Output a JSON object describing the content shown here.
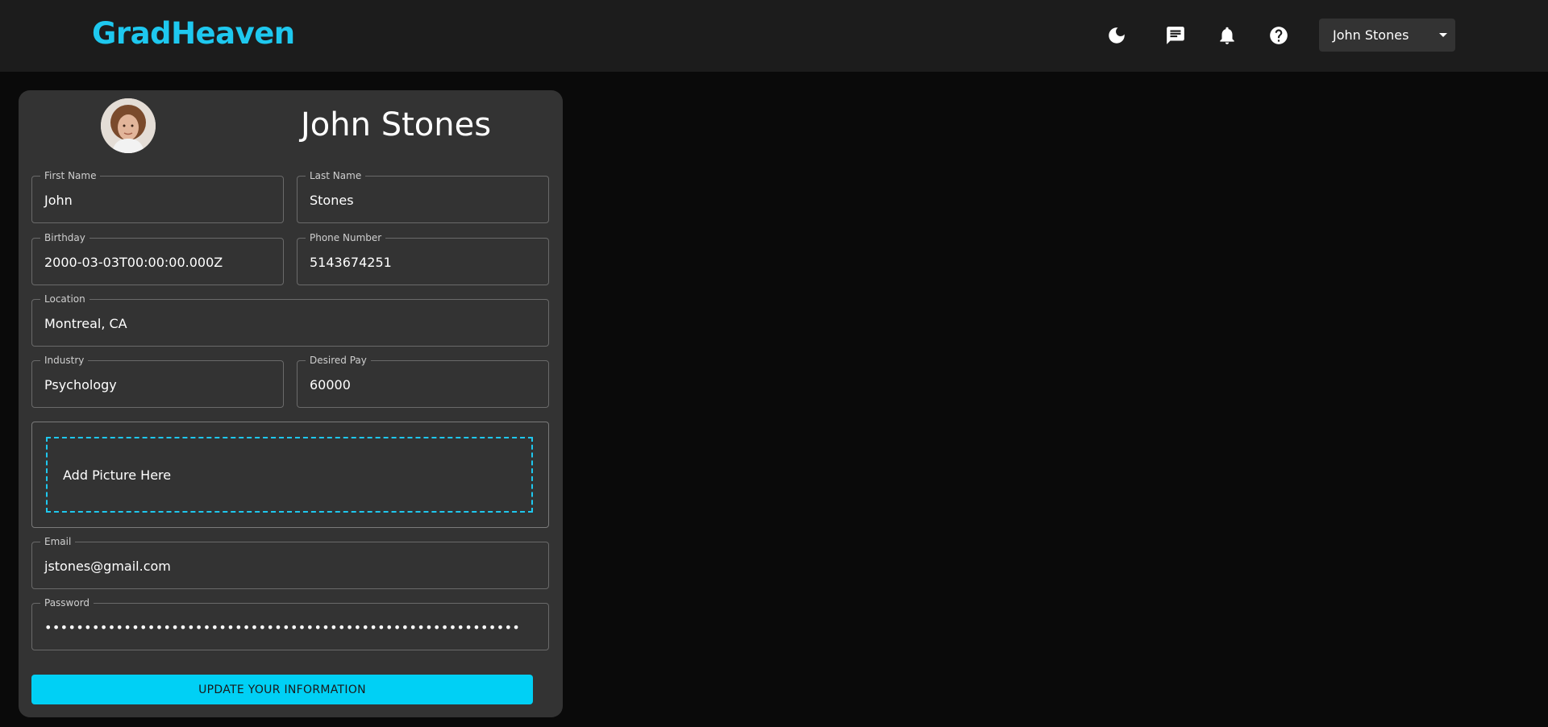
{
  "header": {
    "brand": "GradHeaven",
    "icons": [
      "dark-mode-icon",
      "messages-icon",
      "notifications-icon",
      "help-icon"
    ],
    "user_select": {
      "selected": "John Stones"
    },
    "background": "#1c1c1c",
    "brand_color": "#1ec8ef"
  },
  "profile": {
    "name": "John Stones",
    "fields": {
      "first_name": {
        "label": "First Name",
        "value": "John"
      },
      "last_name": {
        "label": "Last Name",
        "value": "Stones"
      },
      "birthday": {
        "label": "Birthday",
        "value": "2000-03-03T00:00:00.000Z"
      },
      "phone": {
        "label": "Phone Number",
        "value": "5143674251"
      },
      "location": {
        "label": "Location",
        "value": "Montreal, CA"
      },
      "industry": {
        "label": "Industry",
        "value": "Psychology"
      },
      "desired_pay": {
        "label": "Desired Pay",
        "value": "60000"
      },
      "email": {
        "label": "Email",
        "value": "jstones@gmail.com"
      },
      "password": {
        "label": "Password",
        "value": "••••••••••••••••••••••••••••••••••••••••••••••••••••••••••••"
      }
    },
    "dropzone_label": "Add Picture Here",
    "update_button": "UPDATE YOUR INFORMATION",
    "accent_color": "#00d0f5"
  }
}
